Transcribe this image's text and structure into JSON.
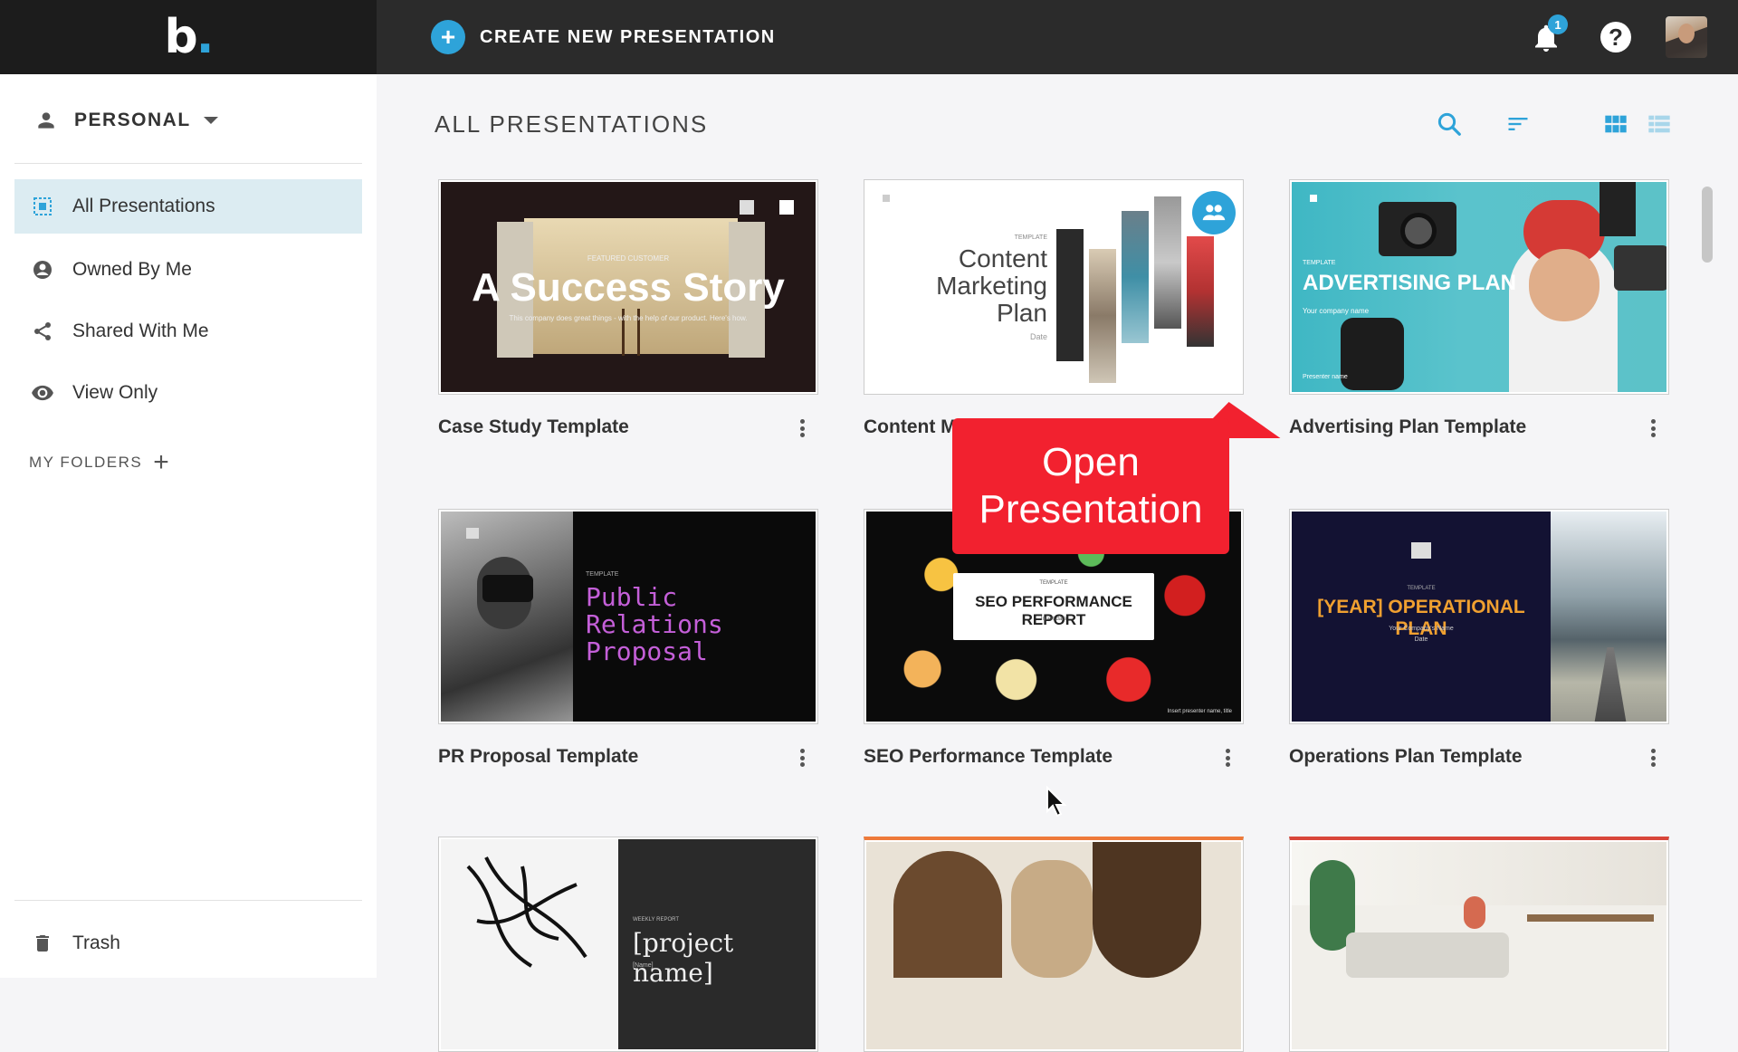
{
  "app": {
    "logo_text": "b",
    "logo_dot": "."
  },
  "topbar": {
    "create_label": "CREATE NEW PRESENTATION",
    "notification_count": "1"
  },
  "sidebar": {
    "account_label": "PERSONAL",
    "items": [
      {
        "label": "All Presentations",
        "icon": "grid-select-icon",
        "active": true
      },
      {
        "label": "Owned By Me",
        "icon": "user-circle-icon",
        "active": false
      },
      {
        "label": "Shared With Me",
        "icon": "share-icon",
        "active": false
      },
      {
        "label": "View Only",
        "icon": "eye-icon",
        "active": false
      }
    ],
    "folders_label": "MY FOLDERS",
    "trash_label": "Trash"
  },
  "main": {
    "title": "ALL PRESENTATIONS",
    "cards": [
      {
        "title": "Case Study Template",
        "thumb_heading": "A Success Story",
        "thumb_sub": "This company does great things - with the help of our product. Here's how.",
        "thumb_kicker": "FEATURED CUSTOMER"
      },
      {
        "title": "Content M",
        "thumb_kicker": "TEMPLATE",
        "thumb_heading": "Content Marketing Plan",
        "thumb_sub": "Date"
      },
      {
        "title": "Advertising Plan Template",
        "thumb_kicker": "TEMPLATE",
        "thumb_heading": "ADVERTISING PLAN",
        "thumb_sub": "Your company name",
        "thumb_footer": "Presenter name"
      },
      {
        "title": "PR Proposal Template",
        "thumb_kicker": "TEMPLATE",
        "thumb_heading": "Public Relations Proposal"
      },
      {
        "title": "SEO Performance Template",
        "thumb_kicker": "TEMPLATE",
        "thumb_heading": "SEO PERFORMANCE REPORT",
        "thumb_sub": "Insert date",
        "thumb_footer": "Insert presenter name, title"
      },
      {
        "title": "Operations Plan Template",
        "thumb_kicker": "TEMPLATE",
        "thumb_heading": "[YEAR] OPERATIONAL PLAN",
        "thumb_sub": "Your Company's Name",
        "thumb_footer": "Date"
      },
      {
        "title": "",
        "thumb_kicker": "WEEKLY REPORT",
        "thumb_heading": "[project name]",
        "thumb_sub": "[Name]"
      },
      {
        "title": ""
      },
      {
        "title": ""
      }
    ]
  },
  "tooltip": {
    "text": "Open Presentation"
  },
  "colors": {
    "accent": "#2ea3d9",
    "tooltip": "#f2212f",
    "topbar": "#2b2b2b"
  }
}
